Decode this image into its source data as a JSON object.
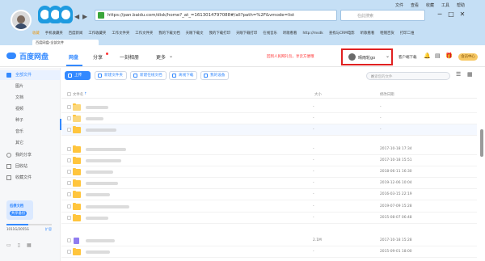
{
  "browser": {
    "url": "https://pan.baidu.com/disk/home?_at_=1613014797088#/all?path=%2F&vmode=list",
    "search_placeholder": "在此搜索",
    "top_links": [
      "文件",
      "查看",
      "收藏",
      "工具",
      "帮助"
    ],
    "window_controls": [
      "─",
      "□",
      "✕"
    ],
    "bookmarks": [
      "收藏",
      "手机收藏夹",
      "百度新闻",
      "工作收藏夹",
      "工作文件夹",
      "工作文件夹",
      "我的下载文档",
      "天眼下载文",
      "我的下载打印",
      "天眼下载打印",
      "在线音乐",
      "听歌看看",
      "http://msdk",
      "查找与CRM电影",
      "听歌看看",
      "鞋帽百货",
      "打印二维"
    ],
    "tab_title": "百度网盘-全部文件"
  },
  "app": {
    "logo": "百度网盘",
    "nav": [
      "网盘",
      "分享",
      "一刻相册",
      "更多"
    ],
    "more_caret": "⌄",
    "promo": "回到人民网礼包，享云方便哦",
    "user_name": "晴雨轮go",
    "client_download": "客户端下载",
    "member_button": "会员中心"
  },
  "sidebar": {
    "items": [
      {
        "label": "全部文件",
        "active": true
      },
      {
        "label": "图片"
      },
      {
        "label": "文档"
      },
      {
        "label": "视频"
      },
      {
        "label": "种子"
      },
      {
        "label": "音乐"
      },
      {
        "label": "其它"
      },
      {
        "label": "我的分享"
      },
      {
        "label": "回收站"
      },
      {
        "label": "收藏文件"
      }
    ],
    "promo_card": {
      "line1": "低债文档",
      "line2": "共享备份"
    },
    "quota_text": "1011G/2055G",
    "quota_fraction": 0.49,
    "quota_expand": "扩容"
  },
  "toolbar": {
    "upload": "上传",
    "new_folder": "新建文件夹",
    "new_online_doc": "新建在线文档",
    "offline_download": "离线下载",
    "my_device": "我的设备",
    "search_placeholder": "搜索您的文件"
  },
  "list": {
    "headers": {
      "name": "文件名",
      "size": "大小",
      "modified": "修改日期"
    },
    "rows": [
      {
        "size": "-",
        "date": "-"
      },
      {
        "size": "-",
        "date": "-"
      },
      {
        "size": "-",
        "date": "-"
      },
      {
        "size": "-",
        "date": "2017-10-18 17:34"
      },
      {
        "size": "-",
        "date": "2017-10-18 15:51"
      },
      {
        "size": "-",
        "date": "2018-06-11 16:30"
      },
      {
        "size": "-",
        "date": "2019-12-06 10:04"
      },
      {
        "size": "-",
        "date": "2016-03-15 22:19"
      },
      {
        "size": "-",
        "date": "2019-07-09 15:28"
      },
      {
        "size": "-",
        "date": "2015-08-07 06:48"
      },
      {
        "size": "2.1M",
        "date": "2017-10-18 15:28"
      },
      {
        "size": "-",
        "date": "2015-09-01 18:00"
      }
    ]
  }
}
